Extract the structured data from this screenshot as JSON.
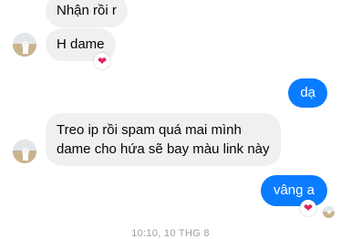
{
  "messages": [
    {
      "id": "m1",
      "direction": "incoming",
      "text": "Nhận rồi r"
    },
    {
      "id": "m2",
      "direction": "incoming",
      "text": "H dame",
      "reaction": "heart"
    },
    {
      "id": "m3",
      "direction": "outgoing",
      "text": "dạ"
    },
    {
      "id": "m4",
      "direction": "incoming",
      "lines": [
        "Treo ip rồi spam quá mai mình",
        "dame cho hứa sẽ bay màu link này"
      ]
    },
    {
      "id": "m5",
      "direction": "outgoing",
      "text": "vâng a",
      "reaction": "heart"
    }
  ],
  "timestamp": "10:10, 10 THG 8",
  "colors": {
    "incoming_bubble": "#f0f0f0",
    "outgoing_bubble": "#0a7cff",
    "reaction_heart": "#e0245e"
  },
  "icons": {
    "reaction": "heart-icon",
    "avatar": "contact-avatar"
  }
}
